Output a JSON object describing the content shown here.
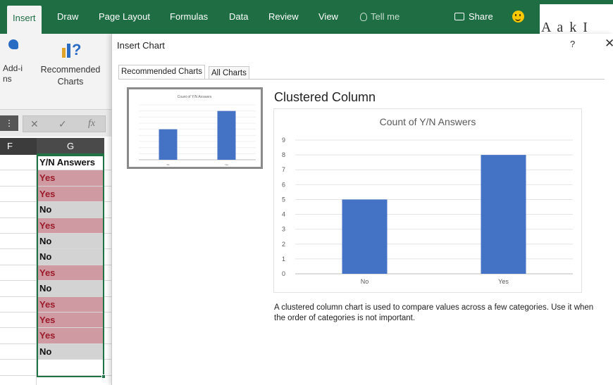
{
  "ribbon": {
    "tabs": [
      "Insert",
      "Draw",
      "Page Layout",
      "Formulas",
      "Data",
      "Review",
      "View"
    ],
    "active_tab": "Insert",
    "tell_me": "Tell me",
    "share": "Share",
    "addins_label": "Add-ins",
    "recommended_label": "Recommended Charts",
    "top_right_fragment": "A a k I"
  },
  "formula_bar": {
    "cancel": "✕",
    "enter": "✓",
    "fx": "fx"
  },
  "sheet": {
    "columns": [
      "F",
      "G"
    ],
    "header": "Y/N Answers",
    "values": [
      "Yes",
      "Yes",
      "No",
      "Yes",
      "No",
      "No",
      "Yes",
      "No",
      "Yes",
      "Yes",
      "Yes",
      "No"
    ]
  },
  "dialog": {
    "title": "Insert Chart",
    "help": "?",
    "close": "✕",
    "tabs": [
      "Recommended Charts",
      "All Charts"
    ],
    "active_tab": "Recommended Charts",
    "chart_type_heading": "Clustered Column",
    "description": "A clustered column chart is used to compare values across a few categories. Use it when the order of categories is not important."
  },
  "chart_data": {
    "type": "bar",
    "title": "Count of Y/N Answers",
    "categories": [
      "No",
      "Yes"
    ],
    "values": [
      5,
      8
    ],
    "ylim": [
      0,
      9
    ],
    "yticks": [
      0,
      1,
      2,
      3,
      4,
      5,
      6,
      7,
      8,
      9
    ],
    "xlabel": "",
    "ylabel": "",
    "grid": true,
    "legend": "none",
    "bar_color": "#4472c4"
  },
  "colors": {
    "ribbon_green": "#1f6e43",
    "yes_fill": "#cf9aa2",
    "yes_text": "#9b1b2a",
    "no_fill": "#d3d3d3",
    "selection": "#217346"
  }
}
